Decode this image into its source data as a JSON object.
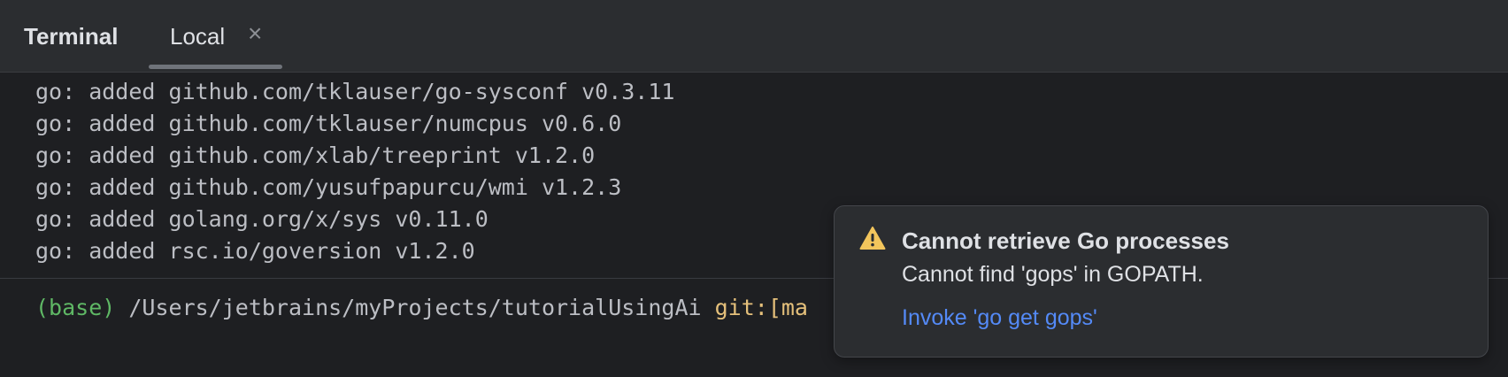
{
  "panel": {
    "title": "Terminal"
  },
  "tabs": [
    {
      "label": "Local",
      "close_icon": "×"
    }
  ],
  "output_lines": [
    "go: added github.com/tklauser/go-sysconf v0.3.11",
    "go: added github.com/tklauser/numcpus v0.6.0",
    "go: added github.com/xlab/treeprint v1.2.0",
    "go: added github.com/yusufpapurcu/wmi v1.2.3",
    "go: added golang.org/x/sys v0.11.0",
    "go: added rsc.io/goversion v1.2.0"
  ],
  "prompt": {
    "env": "(base)",
    "path": " /Users/jetbrains/myProjects/tutorialUsingAi ",
    "git": "git:[ma"
  },
  "notification": {
    "icon": "warning-icon",
    "title": "Cannot retrieve Go processes",
    "message": "Cannot find 'gops' in GOPATH.",
    "action": "Invoke 'go get gops'"
  },
  "colors": {
    "background": "#1e1f22",
    "tabbar": "#2b2d30",
    "env": "#5fb865",
    "git": "#e5c07b",
    "link": "#548af7",
    "warning": "#f2c55c"
  }
}
